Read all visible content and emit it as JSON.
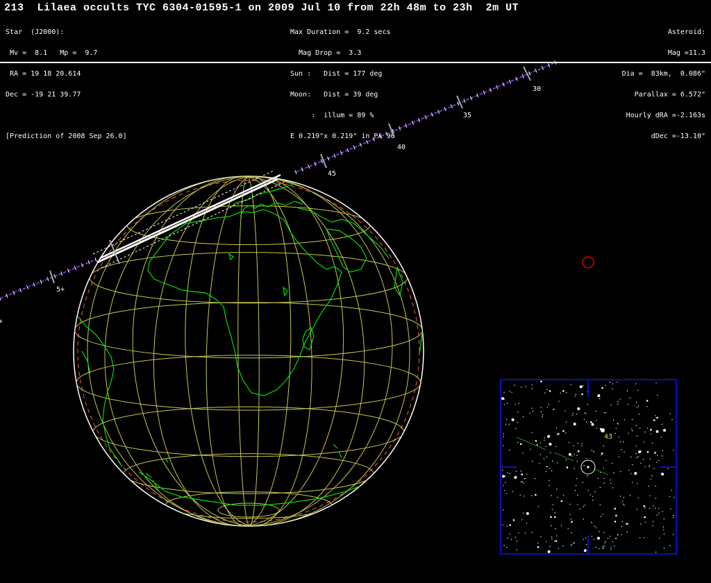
{
  "header": {
    "title": "213  Lilaea occults TYC 6304-01595-1 on 2009 Jul 10 from 22h 48m to 23h  2m UT",
    "star": {
      "heading": "Star  (J2000):",
      "mags": " Mv =  8.1   Mp =  9.7",
      "ra": " RA = 19 18 20.614",
      "dec": "Dec = -19 21 39.77",
      "prediction": "[Prediction of 2008 Sep 26.0]"
    },
    "event": {
      "max_duration": "Max Duration =  9.2 secs",
      "mag_drop": "  Mag Drop =  3.3",
      "sun": "Sun :   Dist = 177 deg",
      "moon": "Moon:   Dist = 39 deg",
      "illum": "     :  illum = 89 %",
      "error_ellipse": "E 0.219\"x 0.219\" in PA 90"
    },
    "asteroid": {
      "heading": "Asteroid:",
      "mag": "Mag =11.3",
      "dia": "Dia =  83km,  0.086\"",
      "parallax": "Parallax = 6.572\"",
      "hourly_dra": "Hourly dRA =-2.163s",
      "ddec": "dDec =-13.10\""
    }
  },
  "track": {
    "tick_labels": [
      "30",
      "35",
      "40",
      "45",
      "5+"
    ],
    "edge_marker": "+"
  },
  "inset": {
    "star_label": "43"
  },
  "colors": {
    "background": "#000000",
    "text": "#ffffff",
    "coastline": "#00e000",
    "graticule": "#c8c850",
    "track": "#9040ff",
    "shadow_path": "#ffffff",
    "limb_dashes": "#ff6040",
    "sun_marker": "#e00000",
    "inset_frame": "#1010ff",
    "inset_path": "#208020"
  }
}
